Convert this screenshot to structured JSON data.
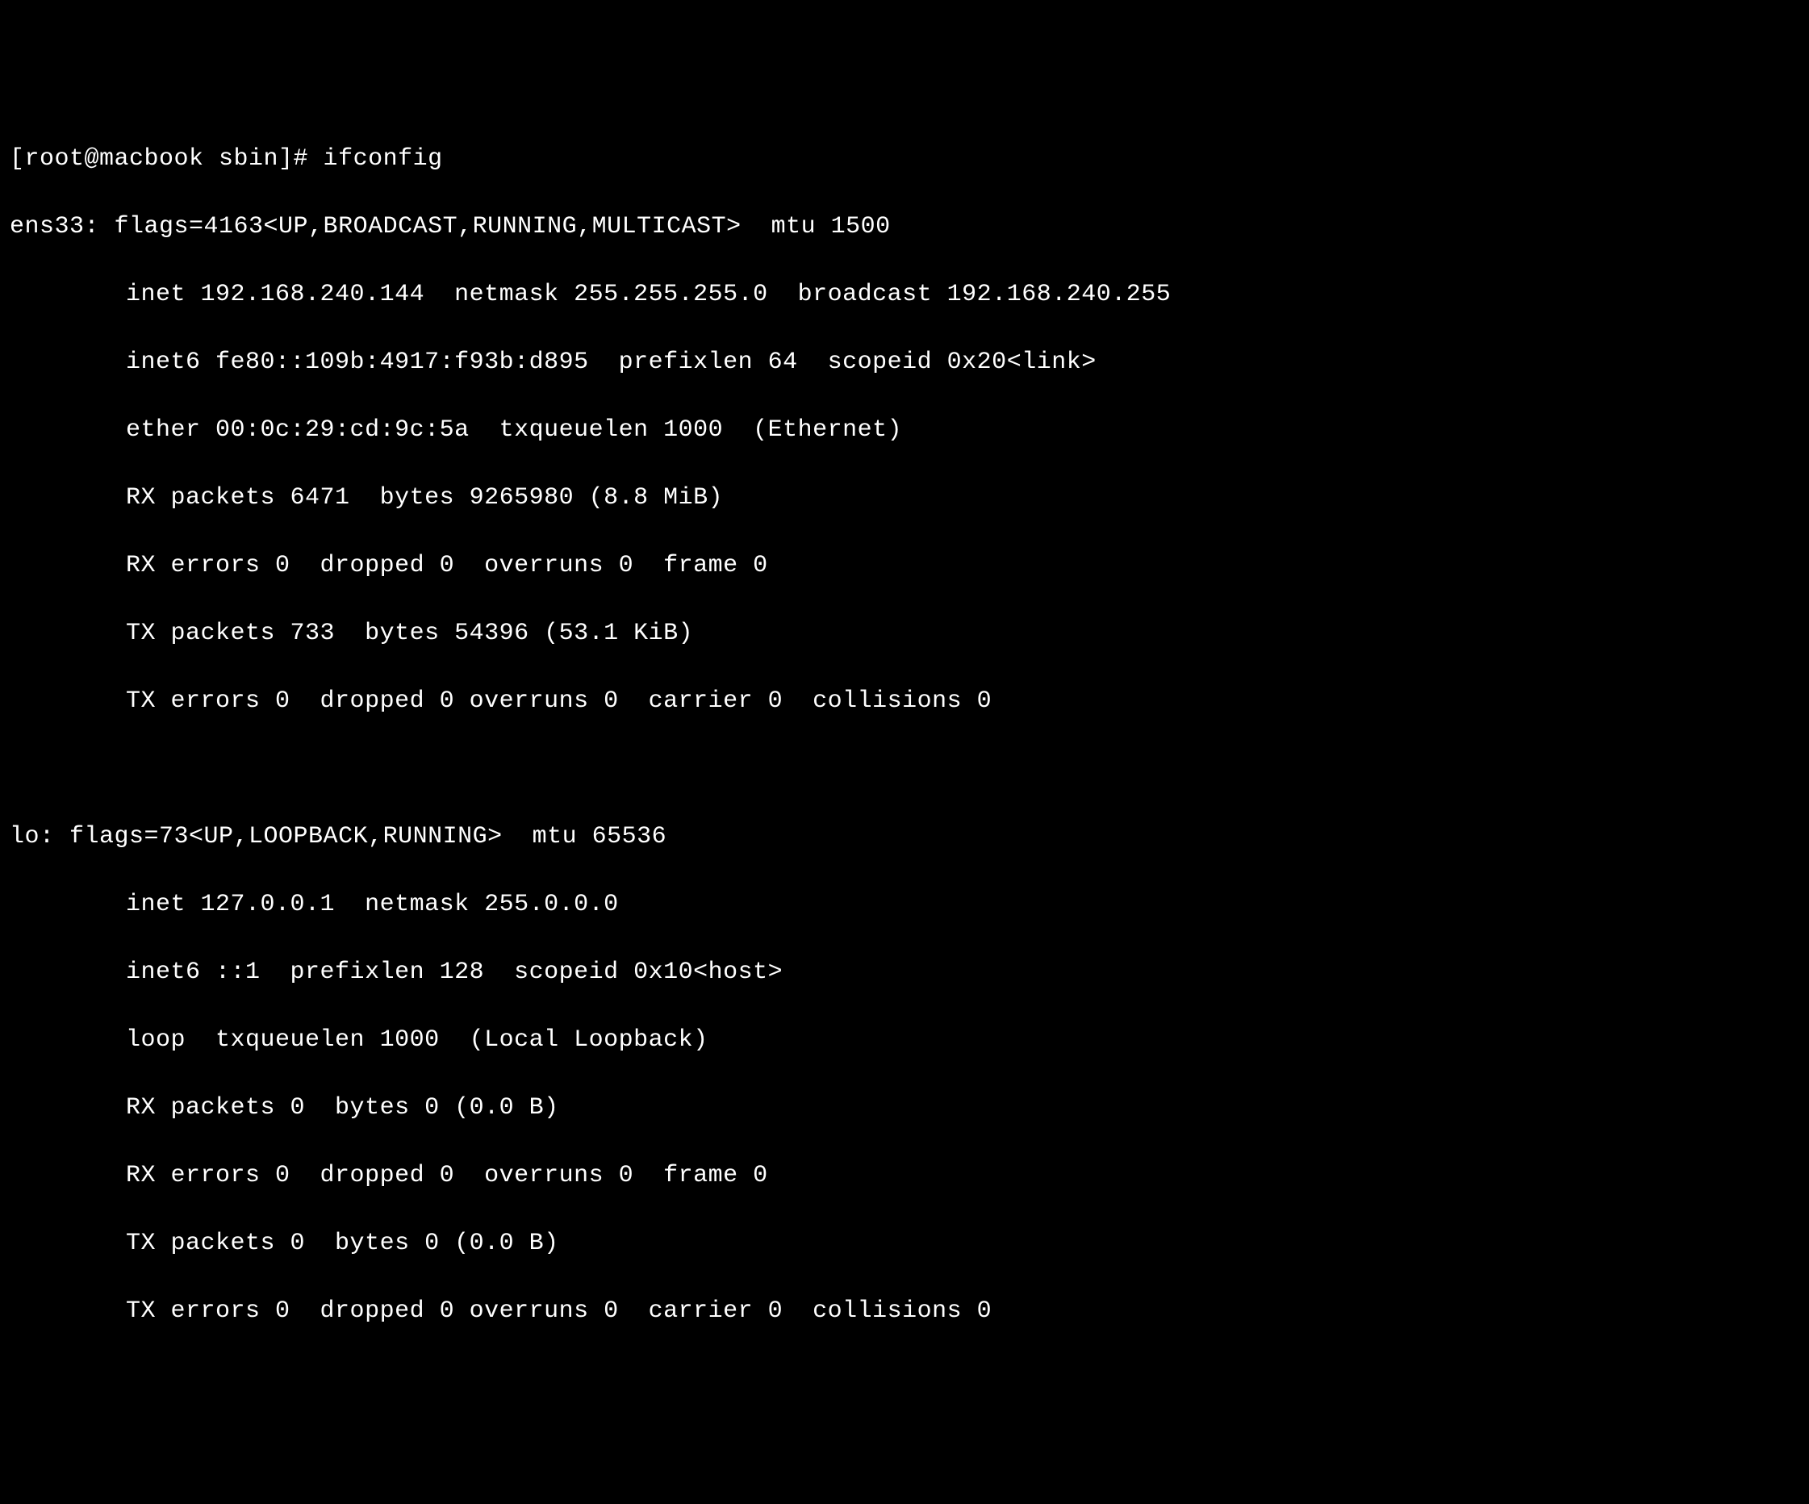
{
  "prompt": "[root@macbook sbin]# ifconfig",
  "iface1": {
    "header": "ens33: flags=4163<UP,BROADCAST,RUNNING,MULTICAST>  mtu 1500",
    "inet": "inet 192.168.240.144  netmask 255.255.255.0  broadcast 192.168.240.255",
    "inet6": "inet6 fe80::109b:4917:f93b:d895  prefixlen 64  scopeid 0x20<link>",
    "ether": "ether 00:0c:29:cd:9c:5a  txqueuelen 1000  (Ethernet)",
    "rxp": "RX packets 6471  bytes 9265980 (8.8 MiB)",
    "rxe": "RX errors 0  dropped 0  overruns 0  frame 0",
    "txp": "TX packets 733  bytes 54396 (53.1 KiB)",
    "txe": "TX errors 0  dropped 0 overruns 0  carrier 0  collisions 0"
  },
  "iface2": {
    "header": "lo: flags=73<UP,LOOPBACK,RUNNING>  mtu 65536",
    "inet": "inet 127.0.0.1  netmask 255.0.0.0",
    "inet6": "inet6 ::1  prefixlen 128  scopeid 0x10<host>",
    "link": "loop  txqueuelen 1000  (Local Loopback)",
    "rxp": "RX packets 0  bytes 0 (0.0 B)",
    "rxe": "RX errors 0  dropped 0  overruns 0  frame 0",
    "txp": "TX packets 0  bytes 0 (0.0 B)",
    "txe": "TX errors 0  dropped 0 overruns 0  carrier 0  collisions 0"
  }
}
